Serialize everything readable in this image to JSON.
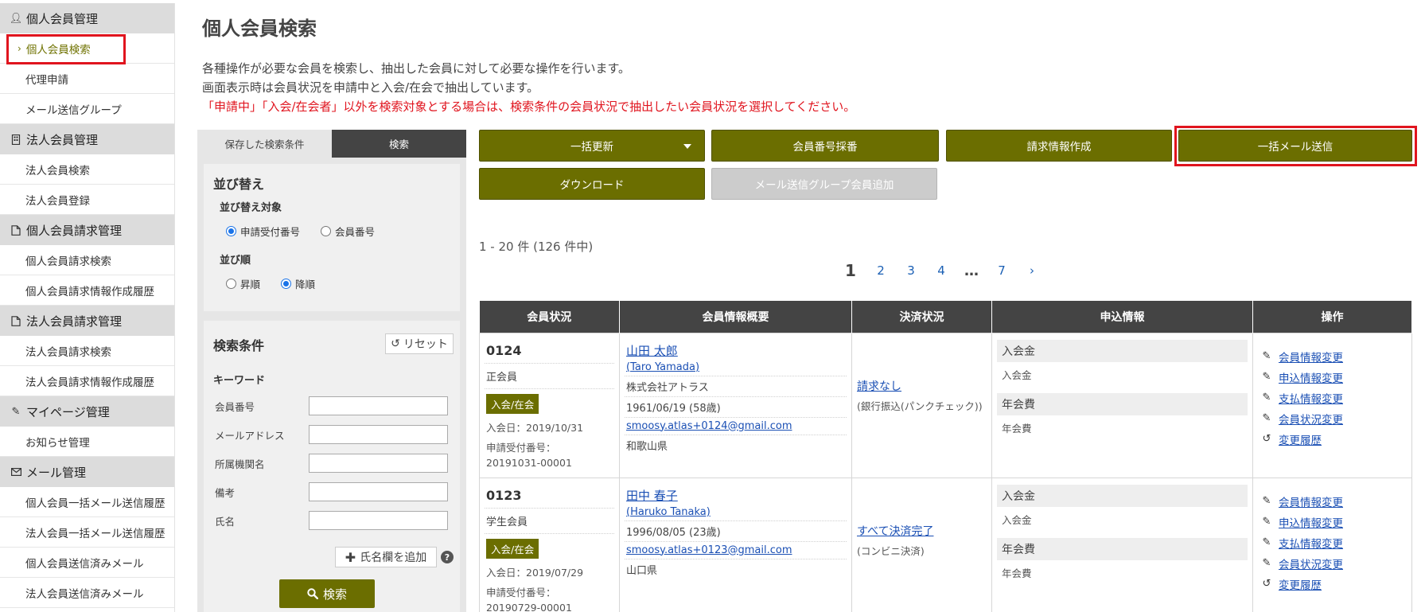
{
  "sidebar": {
    "sections": [
      {
        "icon": "user-icon",
        "label": "個人会員管理",
        "items": [
          {
            "label": "個人会員検索",
            "active": true
          },
          {
            "label": "代理申請"
          },
          {
            "label": "メール送信グループ"
          }
        ]
      },
      {
        "icon": "building-icon",
        "label": "法人会員管理",
        "items": [
          {
            "label": "法人会員検索"
          },
          {
            "label": "法人会員登録"
          }
        ]
      },
      {
        "icon": "document-icon",
        "label": "個人会員請求管理",
        "items": [
          {
            "label": "個人会員請求検索"
          },
          {
            "label": "個人会員請求情報作成履歴"
          }
        ]
      },
      {
        "icon": "document-icon",
        "label": "法人会員請求管理",
        "items": [
          {
            "label": "法人会員請求検索"
          },
          {
            "label": "法人会員請求情報作成履歴"
          }
        ]
      },
      {
        "icon": "pen-icon",
        "label": "マイページ管理",
        "items": [
          {
            "label": "お知らせ管理"
          }
        ]
      },
      {
        "icon": "mail-icon",
        "label": "メール管理",
        "items": [
          {
            "label": "個人会員一括メール送信履歴"
          },
          {
            "label": "法人会員一括メール送信履歴"
          },
          {
            "label": "個人会員送信済みメール"
          },
          {
            "label": "法人会員送信済みメール"
          }
        ]
      }
    ]
  },
  "page": {
    "title": "個人会員検索",
    "desc1": "各種操作が必要な会員を検索し、抽出した会員に対して必要な操作を行います。",
    "desc2": "画面表示時は会員状況を申請中と入会/在会で抽出しています。",
    "desc3": "「申請中」「入会/在会者」以外を検索対象とする場合は、検索条件の会員状況で抽出したい会員状況を選択してください。"
  },
  "panel": {
    "tab_saved": "保存した検索条件",
    "tab_search": "検索",
    "sort_title": "並び替え",
    "sort_target_label": "並び替え対象",
    "sort_target_opt1": "申請受付番号",
    "sort_target_opt2": "会員番号",
    "sort_order_label": "並び順",
    "sort_order_opt1": "昇順",
    "sort_order_opt2": "降順",
    "cond_title": "検索条件",
    "reset_label": "リセット",
    "keyword_label": "キーワード",
    "fields": [
      "会員番号",
      "メールアドレス",
      "所属機関名",
      "備考",
      "氏名"
    ],
    "add_name_label": "氏名欄を追加",
    "search_label": "検索"
  },
  "actions": {
    "bulk_update": "一括更新",
    "assign_number": "会員番号採番",
    "create_billing": "請求情報作成",
    "bulk_mail": "一括メール送信",
    "download": "ダウンロード",
    "add_group": "メール送信グループ会員追加"
  },
  "results": {
    "count_text": "1 - 20 件 (126 件中)",
    "pages": [
      "1",
      "2",
      "3",
      "4",
      "…",
      "7",
      "›"
    ]
  },
  "table": {
    "headers": [
      "会員状況",
      "会員情報概要",
      "決済状況",
      "申込情報",
      "操作"
    ],
    "rows": [
      {
        "member_no": "0124",
        "member_type": "正会員",
        "status": "入会/在会",
        "join_date": "入会日：2019/10/31",
        "app_label": "申請受付番号：",
        "app_no": "20191031-00001",
        "name": "山田 太郎",
        "name_roman": "(Taro Yamada)",
        "org": "株式会社アトラス",
        "birth": "1961/06/19 (58歳)",
        "email": "smoosy.atlas+0124@gmail.com",
        "pref": "和歌山県",
        "pay_status": "請求なし",
        "pay_method": "(銀行振込(パンクチェック))",
        "app_head1": "入会金",
        "app_sub1": "入会金",
        "app_head2": "年会費",
        "app_sub2": "年会費"
      },
      {
        "member_no": "0123",
        "member_type": "学生会員",
        "status": "入会/在会",
        "join_date": "入会日：2019/07/29",
        "app_label": "申請受付番号：",
        "app_no": "20190729-00001",
        "name": "田中 春子",
        "name_roman": "(Haruko Tanaka)",
        "org": "",
        "birth": "1996/08/05 (23歳)",
        "email": "smoosy.atlas+0123@gmail.com",
        "pref": "山口県",
        "pay_status": "すべて決済完了",
        "pay_method": "(コンビニ決済)",
        "app_head1": "入会金",
        "app_sub1": "入会金",
        "app_head2": "年会費",
        "app_sub2": "年会費"
      }
    ],
    "operations": [
      "会員情報変更",
      "申込情報変更",
      "支払情報変更",
      "会員状況変更",
      "変更履歴"
    ]
  }
}
